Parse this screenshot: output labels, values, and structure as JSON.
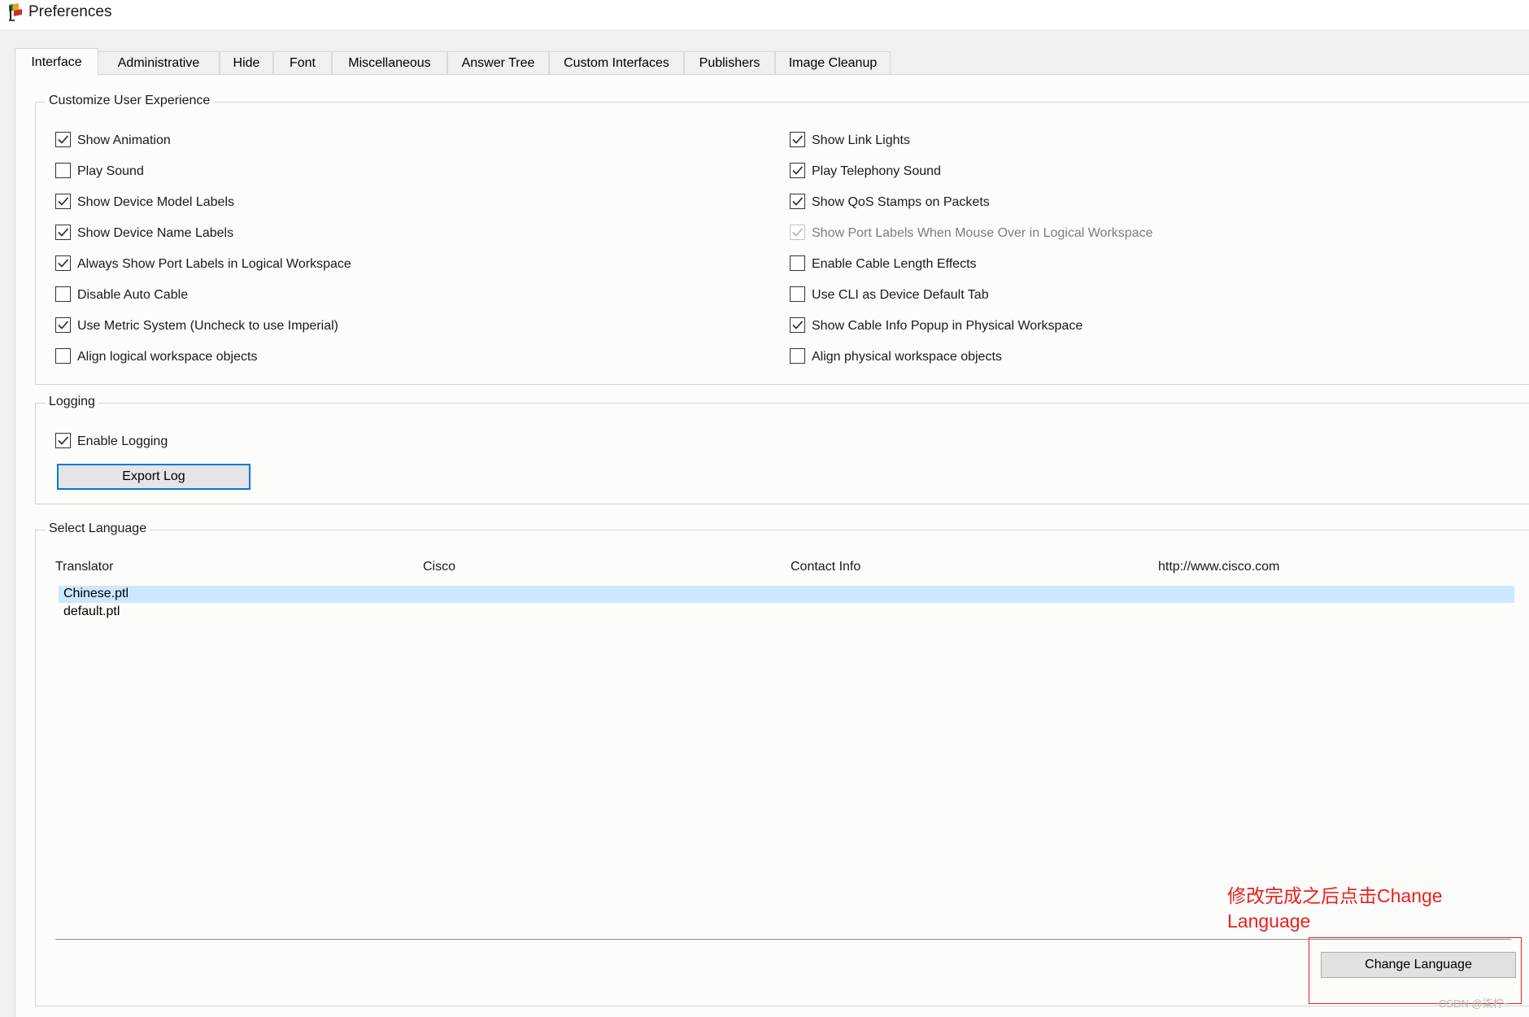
{
  "window": {
    "title": "Preferences",
    "icon": "packet-tracer-icon"
  },
  "tabs": [
    {
      "label": "Interface",
      "active": true
    },
    {
      "label": "Administrative"
    },
    {
      "label": "Hide"
    },
    {
      "label": "Font"
    },
    {
      "label": "Miscellaneous"
    },
    {
      "label": "Answer Tree"
    },
    {
      "label": "Custom Interfaces"
    },
    {
      "label": "Publishers"
    },
    {
      "label": "Image Cleanup"
    }
  ],
  "ux": {
    "legend": "Customize User Experience",
    "left": [
      {
        "label": "Show Animation",
        "checked": true
      },
      {
        "label": "Play Sound",
        "checked": false
      },
      {
        "label": "Show Device Model Labels",
        "checked": true
      },
      {
        "label": "Show Device Name Labels",
        "checked": true
      },
      {
        "label": "Always Show Port Labels in Logical Workspace",
        "checked": true
      },
      {
        "label": "Disable Auto Cable",
        "checked": false
      },
      {
        "label": "Use Metric System (Uncheck to use Imperial)",
        "checked": true
      },
      {
        "label": "Align logical workspace objects",
        "checked": false
      }
    ],
    "right": [
      {
        "label": "Show Link Lights",
        "checked": true
      },
      {
        "label": "Play Telephony Sound",
        "checked": true
      },
      {
        "label": "Show QoS Stamps on Packets",
        "checked": true
      },
      {
        "label": "Show Port Labels When Mouse Over in Logical Workspace",
        "checked": true,
        "disabled": true
      },
      {
        "label": "Enable Cable Length Effects",
        "checked": false
      },
      {
        "label": "Use CLI as Device Default Tab",
        "checked": false
      },
      {
        "label": "Show Cable Info Popup in Physical Workspace",
        "checked": true
      },
      {
        "label": "Align physical workspace objects",
        "checked": false
      }
    ]
  },
  "logging": {
    "legend": "Logging",
    "enable": {
      "label": "Enable Logging",
      "checked": true
    },
    "export_button": "Export Log"
  },
  "language": {
    "legend": "Select Language",
    "columns": [
      "Translator",
      "Cisco",
      "Contact Info",
      "http://www.cisco.com"
    ],
    "items": [
      {
        "label": "Chinese.ptl",
        "selected": true
      },
      {
        "label": "default.ptl",
        "selected": false
      }
    ],
    "change_button": "Change Language"
  },
  "annotation": {
    "line1": "修改完成之后点击Change",
    "line2": "Language",
    "color": "#e8211f"
  },
  "watermark": "CSDN @柒柠~",
  "colors": {
    "selection": "#cce8ff",
    "focus_border": "#0078d7",
    "panel": "#fcfcfa"
  }
}
